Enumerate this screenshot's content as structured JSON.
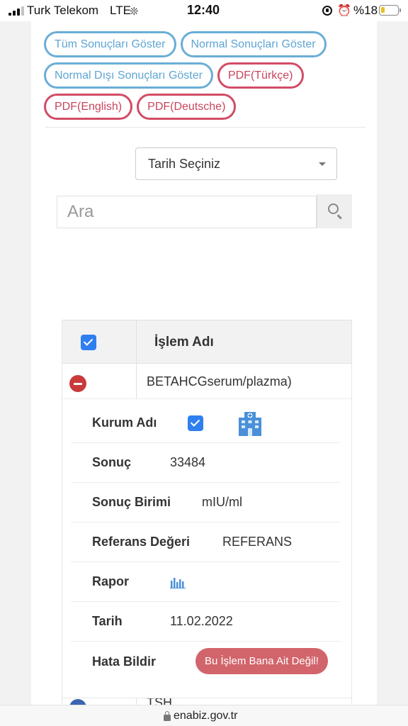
{
  "status_bar": {
    "carrier": "Turk Telekom",
    "network": "LTE",
    "time": "12:40",
    "battery": "%18",
    "battery_level_percent": 18,
    "signal_bars_active": 3,
    "signal_bars_total": 4
  },
  "filters": {
    "show_all": "Tüm Sonuçları Göster",
    "show_normal": "Normal Sonuçları Göster",
    "show_abnormal": "Normal Dışı Sonuçları Göster",
    "pdf_turkish": "PDF(Türkçe)",
    "pdf_english": "PDF(English)",
    "pdf_german": "PDF(Deutsche)"
  },
  "date_select": {
    "value": "Tarih Seçiniz"
  },
  "search": {
    "placeholder": "Ara"
  },
  "table": {
    "header_label": "İşlem Adı",
    "header_checked": true,
    "row": {
      "name": "BETAHCGserum/plazma)",
      "expanded": true,
      "details": {
        "institution_label": "Kurum Adı",
        "result_label": "Sonuç",
        "result_value": "33484",
        "unit_label": "Sonuç Birimi",
        "unit_value": "mIU/ml",
        "reference_label": "Referans Değeri",
        "reference_value": "REFERANS",
        "report_label": "Rapor",
        "date_label": "Tarih",
        "date_value": "11.02.2022",
        "error_label": "Hata Bildir",
        "error_button": "Bu İşlem Bana Ait Değil!"
      }
    },
    "next_row_name": "TSH"
  },
  "url_bar": {
    "url": "enabiz.gov.tr"
  },
  "colors": {
    "filter_blue": "#6aaed6",
    "pdf_red": "#d24c66",
    "checkbox_blue": "#2f7ff0",
    "collapse_red": "#c93a3a",
    "error_button": "#d2646b",
    "icon_blue": "#4a90d9"
  },
  "icons": {
    "signal": "cellular-signal-icon",
    "loading": "loading-spinner-icon",
    "orientation_lock": "orientation-lock-icon",
    "alarm": "alarm-clock-icon",
    "battery": "battery-icon",
    "dropdown": "chevron-down-icon",
    "search": "search-icon",
    "collapse": "minus-circle-icon",
    "hospital": "hospital-building-icon",
    "report": "bar-chart-icon",
    "secure": "padlock-icon"
  }
}
